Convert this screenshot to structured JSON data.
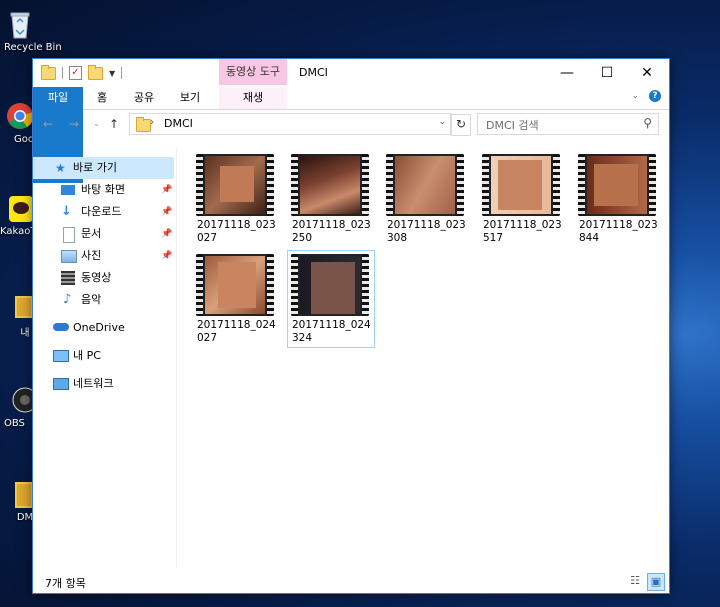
{
  "desktop": {
    "icons": [
      {
        "label": "Recycle Bin"
      },
      {
        "label": "Google Chrome"
      },
      {
        "label": "KakaoTalk"
      },
      {
        "label": "내"
      },
      {
        "label": "OBS"
      },
      {
        "label": "DM"
      }
    ]
  },
  "window": {
    "title": "DMCI",
    "context_tab": "동영상 도구",
    "ribbon_tabs": {
      "file": "파일",
      "home": "홈",
      "share": "공유",
      "view": "보기",
      "play": "재생"
    },
    "address": {
      "path": "DMCI"
    },
    "search": {
      "placeholder": "DMCI 검색"
    },
    "nav": {
      "quick_access": "바로 가기",
      "desktop": "바탕 화면",
      "downloads": "다운로드",
      "documents": "문서",
      "pictures": "사진",
      "videos": "동영상",
      "music": "음악",
      "onedrive": "OneDrive",
      "this_pc": "내 PC",
      "network": "네트워크"
    },
    "files": [
      {
        "name": "20171118_023027"
      },
      {
        "name": "20171118_023250"
      },
      {
        "name": "20171118_023308"
      },
      {
        "name": "20171118_023517"
      },
      {
        "name": "20171118_023844"
      },
      {
        "name": "20171118_024027"
      },
      {
        "name": "20171118_024324"
      }
    ],
    "status": "7개 항목"
  },
  "colors": {
    "accent": "#1979ca",
    "selection": "#cce8ff",
    "context_tab": "#f7c7e3"
  }
}
